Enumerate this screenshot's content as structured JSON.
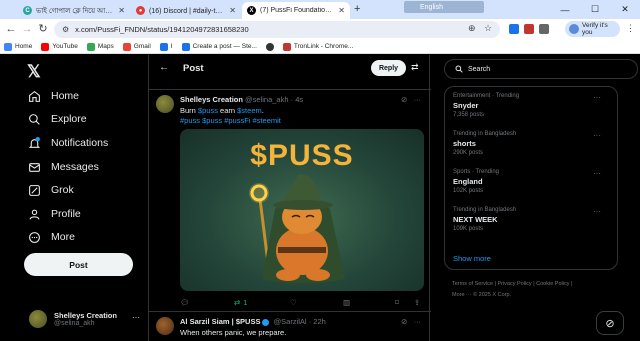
{
  "browser": {
    "tabs": [
      {
        "title": "ভাই গোপাল ক্লে দিয়ে আবাদেন ?",
        "active": false
      },
      {
        "title": "(16) Discord | #daily-tasks | পালা",
        "active": false
      },
      {
        "title": "(7) PussFi Foundation on X: \"B",
        "active": true
      }
    ],
    "translate_widget": "English",
    "url": "x.com/PussFi_FNDN/status/1941204972831658230",
    "verify_label": "Verify it's you",
    "bookmarks": [
      {
        "label": "Home",
        "color": "#4285f4"
      },
      {
        "label": "YouTube",
        "color": "#ff0000"
      },
      {
        "label": "Maps",
        "color": "#34a853"
      },
      {
        "label": "Gmail",
        "color": "#ea4335"
      },
      {
        "label": "I",
        "color": "#1a73e8"
      },
      {
        "label": "Create a post — Ste...",
        "color": "#1a73e8"
      },
      {
        "label": "",
        "color": "#333333"
      },
      {
        "label": "TronLink - Chrome...",
        "color": "#c23631"
      }
    ]
  },
  "sidebar": {
    "logo": "𝕏",
    "items": [
      {
        "label": "Home",
        "icon": "home-icon"
      },
      {
        "label": "Explore",
        "icon": "search-icon"
      },
      {
        "label": "Notifications",
        "icon": "bell-icon"
      },
      {
        "label": "Messages",
        "icon": "mail-icon"
      },
      {
        "label": "Grok",
        "icon": "grok-icon"
      },
      {
        "label": "Profile",
        "icon": "person-icon"
      },
      {
        "label": "More",
        "icon": "more-circle-icon"
      }
    ],
    "post_button": "Post",
    "account": {
      "name": "Shelleys Creation",
      "handle": "@selina_akh",
      "more": "···"
    }
  },
  "main": {
    "title": "Post",
    "reply_button": "Reply",
    "tweet": {
      "author": "Shelleys Creation",
      "handle": "@selina_akh",
      "time": "· 4s",
      "text_prefix": "Burn ",
      "text_link1": "$puss",
      "text_mid": " earn ",
      "text_link2": "$steem",
      "text_suffix": ".",
      "hashtags": "#puss $puss #pussFi #steemit",
      "image_text": "$PUSS",
      "retweets": "1"
    },
    "tweet2": {
      "author": "Al Sarzil Siam | $PUSS",
      "handle": "@SarzilAl",
      "time": "· 22h",
      "text": "When others panic, we prepare."
    }
  },
  "right": {
    "search_placeholder": "Search",
    "trends": [
      {
        "category": "Entertainment · Trending",
        "title": "Snyder",
        "count": "7,358 posts"
      },
      {
        "category": "Trending in Bangladesh",
        "title": "shorts",
        "count": "290K posts"
      },
      {
        "category": "Sports · Trending",
        "title": "England",
        "count": "102K posts"
      },
      {
        "category": "Trending in Bangladesh",
        "title": "NEXT WEEK",
        "count": "109K posts"
      }
    ],
    "show_more": "Show more",
    "footer_line1": "Terms of Service  |  Privacy Policy  |  Cookie Policy  |",
    "footer_line2": "More ···  © 2025 X Corp."
  }
}
